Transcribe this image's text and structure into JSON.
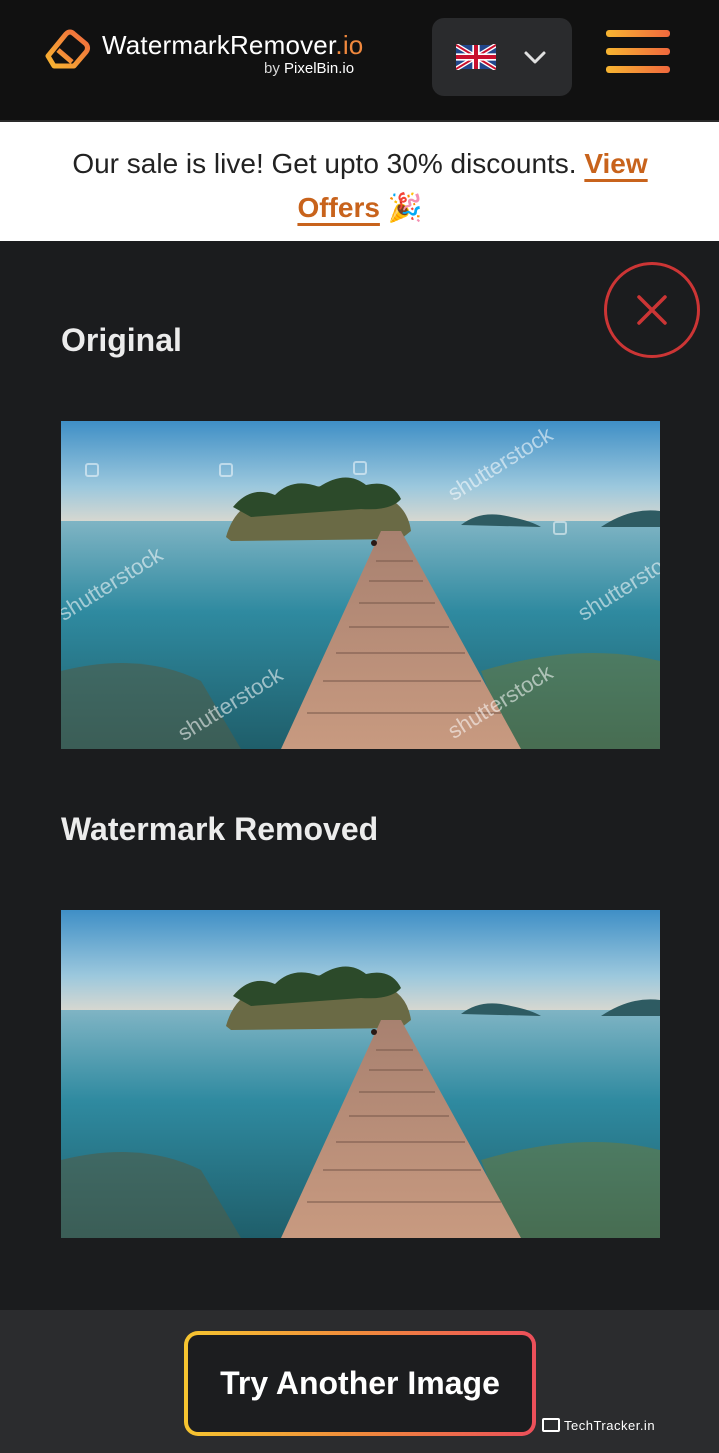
{
  "header": {
    "brand": "WatermarkRemover",
    "brand_suffix": ".io",
    "byline_prefix": "by",
    "byline_name": "PixelBin.io",
    "language_icon": "uk-flag-icon",
    "menu_icon": "hamburger-menu-icon"
  },
  "banner": {
    "text": "Our sale is live! Get upto 30% discounts. ",
    "link_label": "View Offers",
    "emoji": "🎉"
  },
  "result": {
    "close_icon": "close-icon",
    "original_title": "Original",
    "removed_title": "Watermark Removed",
    "watermark_text": "shutterstock"
  },
  "footer": {
    "try_button": "Try Another Image",
    "badge": "TechTracker.in"
  },
  "colors": {
    "accent_orange": "#c8631c",
    "close_red": "#cc3535",
    "gradient_start": "#f6c530",
    "gradient_end": "#ec4f5a",
    "background": "#1b1c1e"
  }
}
